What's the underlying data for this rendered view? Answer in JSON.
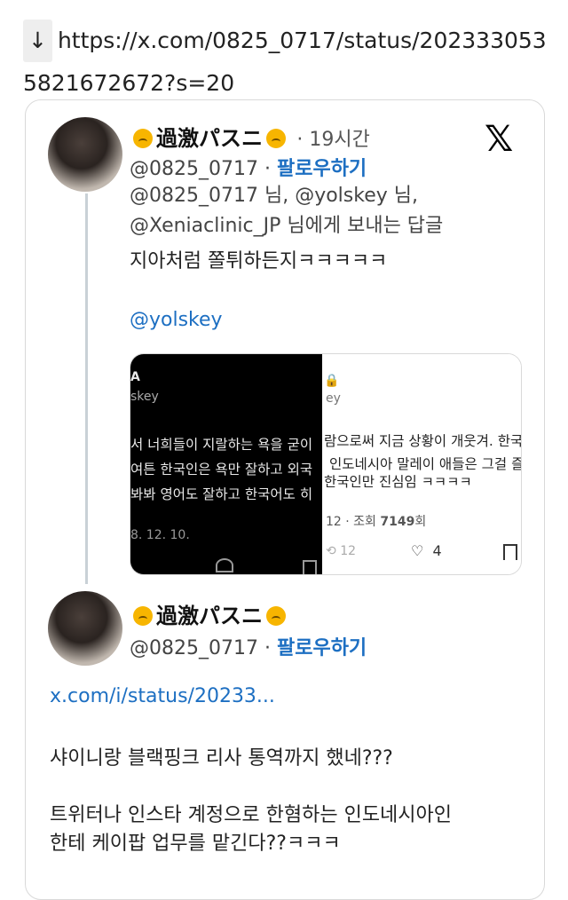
{
  "url_bar": {
    "arrow": "↓",
    "url": "https://x.com/0825_0717/status/2023330535821672672?s=20"
  },
  "tweet1": {
    "display_name": "過激パスニ",
    "time": "· 19시간",
    "handle": "@0825_0717",
    "follow_label": "팔로우하기",
    "reply_line1": "@0825_0717 님, @yolskey 님,",
    "reply_line2": "@Xeniaclinic_JP 님에게 보내는 답글",
    "body": "지아처럼 쫄튀하든지ㅋㅋㅋㅋㅋ",
    "mention": "@yolskey",
    "media": {
      "left_name": "A",
      "left_handle": "skey",
      "left_line1": "서 너희들이 지랄하는 욕을 굳이",
      "left_line2": "여튼 한국인은 욕만 잘하고 외국",
      "left_line3": "봐봐 영어도 잘하고 한국어도 히",
      "left_date": "8. 12. 10.",
      "right_lock": "🔒",
      "right_handle": "ey",
      "right_line1": "람으로써 지금 상황이 개웃겨. 한국",
      "right_line2": "인도네시아 말레이 애들은 그걸 즐기",
      "right_line3": "한국인만 진심임 ㅋㅋㅋㅋ",
      "right_stats_prefix": "12 · 조회 ",
      "right_views": "7149",
      "right_views_suffix": "회",
      "right_retweets": "12",
      "right_likes": "4"
    }
  },
  "tweet2": {
    "display_name": "過激パスニ",
    "handle": "@0825_0717",
    "follow_label": "팔로우하기",
    "link": "x.com/i/status/20233...",
    "line1": "샤이니랑 블랙핑크 리사 통역까지 했네???",
    "line2": "트위터나 인스타 계정으로  한혐하는 인도네시아인",
    "line3": "한테 케이팝 업무를 맡긴다??ㅋㅋㅋ"
  },
  "icons": [
    "x-logo-icon",
    "heart-icon",
    "bookmark-icon",
    "retweet-icon",
    "lock-icon",
    "grimace-emoji-icon"
  ]
}
